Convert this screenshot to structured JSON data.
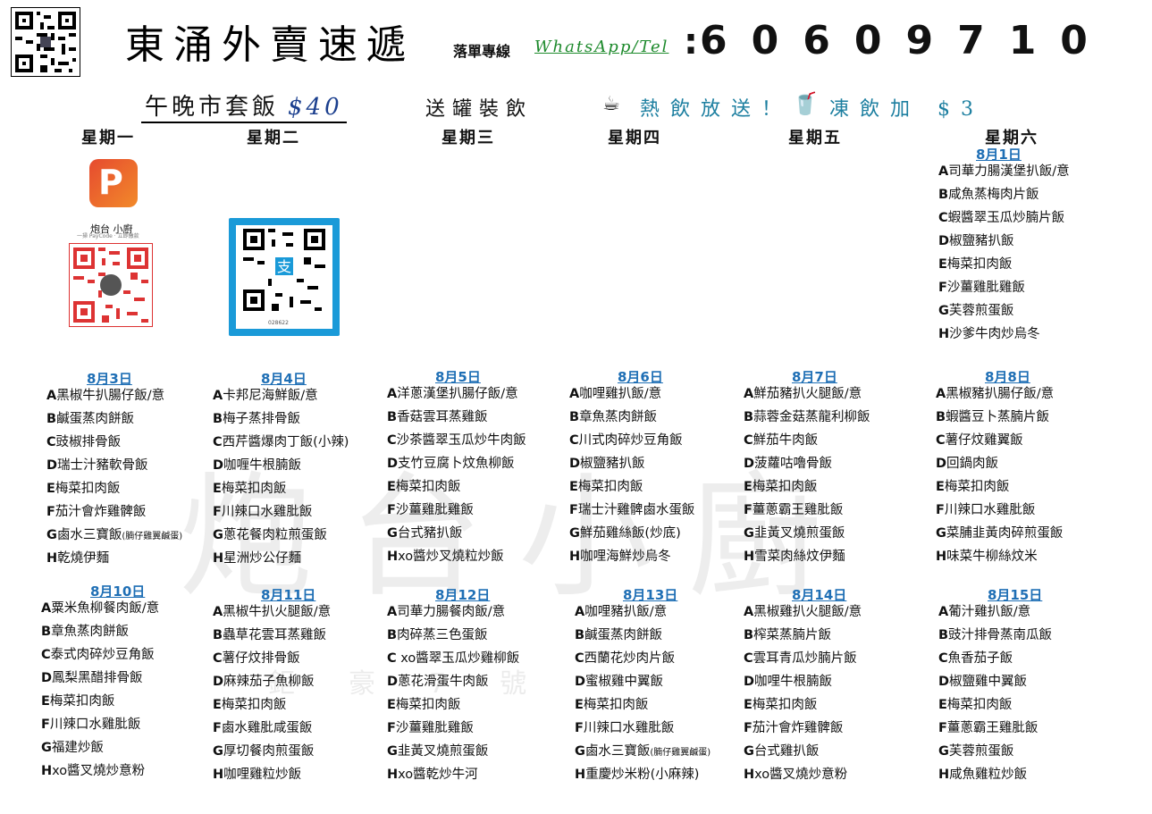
{
  "header": {
    "title": "東涌外賣速遞",
    "hotline_label": "落單專線",
    "hotline_channel": "WhatsApp/Tel",
    "hotline_colon": ":",
    "phone": "60609710"
  },
  "promo": {
    "set_meal": "午晚市套飯",
    "set_price": "$40",
    "free_can": "送罐裝飲",
    "coffee_icon": "☕",
    "hot_drink": "熱飲放送！",
    "cup_icon": "🥤",
    "cold_drink": "凍飲加 $3"
  },
  "weekdays": [
    "星期一",
    "星期二",
    "星期三",
    "星期四",
    "星期五",
    "星期六"
  ],
  "payment": {
    "kitchen_name": "炮台 小廚",
    "kitchen_sub": "一掃 PayCode · 立即繳款",
    "alipay_code": "028622"
  },
  "watermark": {
    "big": "炮台小廚",
    "small": "鉅豪7號"
  },
  "days": [
    {
      "date": "8月1日",
      "dishes": [
        {
          "l": "A",
          "t": "司華力腸漢堡扒飯/意"
        },
        {
          "l": "B",
          "t": "咸魚蒸梅肉片飯"
        },
        {
          "l": "C",
          "t": "蝦醬翠玉瓜炒腩片飯"
        },
        {
          "l": "D",
          "t": "椒鹽豬扒飯"
        },
        {
          "l": "E",
          "t": "梅菜扣肉飯"
        },
        {
          "l": "F",
          "t": "沙薑雞肶雞飯"
        },
        {
          "l": "G",
          "t": "芙蓉煎蛋飯"
        },
        {
          "l": "H",
          "t": "沙爹牛肉炒烏冬"
        }
      ]
    },
    {
      "date": "8月3日",
      "dishes": [
        {
          "l": "A",
          "t": "黑椒牛扒腸仔飯/意"
        },
        {
          "l": "B",
          "t": "鹹蛋蒸肉餅飯"
        },
        {
          "l": "C",
          "t": "豉椒排骨飯"
        },
        {
          "l": "D",
          "t": "瑞士汁豬軟骨飯"
        },
        {
          "l": "E",
          "t": "梅菜扣肉飯"
        },
        {
          "l": "F",
          "t": "茄汁會炸雞髀飯"
        },
        {
          "l": "G",
          "t": "鹵水三寶飯",
          "s": "(腩仔雞翼鹹蛋)"
        },
        {
          "l": "H",
          "t": "乾燒伊麵"
        }
      ]
    },
    {
      "date": "8月4日",
      "dishes": [
        {
          "l": "A",
          "t": "卡邦尼海鮮飯/意"
        },
        {
          "l": "B",
          "t": "梅子蒸排骨飯"
        },
        {
          "l": "C",
          "t": "西芹醬爆肉丁飯(小辣)"
        },
        {
          "l": "D",
          "t": "咖喱牛根腩飯"
        },
        {
          "l": "E",
          "t": "梅菜扣肉飯"
        },
        {
          "l": "F",
          "t": "川辣口水雞肶飯"
        },
        {
          "l": "G",
          "t": "蔥花餐肉粒煎蛋飯"
        },
        {
          "l": "H",
          "t": "星洲炒公仔麵"
        }
      ]
    },
    {
      "date": "8月5日",
      "dishes": [
        {
          "l": "A",
          "t": "洋蔥漢堡扒腸仔飯/意"
        },
        {
          "l": "B",
          "t": "香菇雲耳蒸雞飯"
        },
        {
          "l": "C",
          "t": "沙茶醬翠玉瓜炒牛肉飯"
        },
        {
          "l": "D",
          "t": "支竹豆腐卜炆魚柳飯"
        },
        {
          "l": "E",
          "t": "梅菜扣肉飯"
        },
        {
          "l": "F",
          "t": "沙薑雞肶雞飯"
        },
        {
          "l": "G",
          "t": "台式豬扒飯"
        },
        {
          "l": "H",
          "t": "xo醬炒叉燒粒炒飯"
        }
      ]
    },
    {
      "date": "8月6日",
      "dishes": [
        {
          "l": "A",
          "t": "咖哩雞扒飯/意"
        },
        {
          "l": "B",
          "t": "章魚蒸肉餅飯"
        },
        {
          "l": "C",
          "t": "川式肉碎炒豆角飯"
        },
        {
          "l": "D",
          "t": "椒鹽豬扒飯"
        },
        {
          "l": "E",
          "t": "梅菜扣肉飯"
        },
        {
          "l": "F",
          "t": "瑞士汁雞髀鹵水蛋飯"
        },
        {
          "l": "G",
          "t": "鮮茄雞絲飯(炒底)"
        },
        {
          "l": "H",
          "t": "咖哩海鮮炒烏冬"
        }
      ]
    },
    {
      "date": "8月7日",
      "dishes": [
        {
          "l": "A",
          "t": "鮮茄豬扒火腿飯/意"
        },
        {
          "l": "B",
          "t": "蒜蓉金菇蒸龍利柳飯"
        },
        {
          "l": "C",
          "t": "鮮茄牛肉飯"
        },
        {
          "l": "D",
          "t": "菠蘿咕嚕骨飯"
        },
        {
          "l": "E",
          "t": "梅菜扣肉飯"
        },
        {
          "l": "F",
          "t": "薑蔥霸王雞肶飯"
        },
        {
          "l": "G",
          "t": "韭黃叉燒煎蛋飯"
        },
        {
          "l": "H",
          "t": "雪菜肉絲炆伊麵"
        }
      ]
    },
    {
      "date": "8月8日",
      "dishes": [
        {
          "l": "A",
          "t": "黑椒豬扒腸仔飯/意"
        },
        {
          "l": "B",
          "t": "蝦醬豆卜蒸腩片飯"
        },
        {
          "l": "C",
          "t": "薯仔炆雞翼飯"
        },
        {
          "l": "D",
          "t": "回鍋肉飯"
        },
        {
          "l": "E",
          "t": "梅菜扣肉飯"
        },
        {
          "l": "F",
          "t": "川辣口水雞肶飯"
        },
        {
          "l": "G",
          "t": "菜脯韭黃肉碎煎蛋飯"
        },
        {
          "l": "H",
          "t": "味菜牛柳絲炆米"
        }
      ]
    },
    {
      "date": "8月10日",
      "dishes": [
        {
          "l": "A",
          "t": "粟米魚柳餐肉飯/意"
        },
        {
          "l": "B",
          "t": "章魚蒸肉餅飯"
        },
        {
          "l": "C",
          "t": "泰式肉碎炒豆角飯"
        },
        {
          "l": "D",
          "t": "鳳梨黑醋排骨飯"
        },
        {
          "l": "E",
          "t": "梅菜扣肉飯"
        },
        {
          "l": "F",
          "t": "川辣口水雞肶飯"
        },
        {
          "l": "G",
          "t": "福建炒飯"
        },
        {
          "l": "H",
          "t": "xo醬叉燒炒意粉"
        }
      ]
    },
    {
      "date": "8月11日",
      "dishes": [
        {
          "l": "A",
          "t": "黑椒牛扒火腿飯/意"
        },
        {
          "l": "B",
          "t": "蟲草花雲耳蒸雞飯"
        },
        {
          "l": "C",
          "t": "薯仔炆排骨飯"
        },
        {
          "l": "D",
          "t": "麻辣茄子魚柳飯"
        },
        {
          "l": "E",
          "t": "梅菜扣肉飯"
        },
        {
          "l": "F",
          "t": "鹵水雞肶咸蛋飯"
        },
        {
          "l": "G",
          "t": "厚切餐肉煎蛋飯"
        },
        {
          "l": "H",
          "t": "咖哩雞粒炒飯"
        }
      ]
    },
    {
      "date": "8月12日",
      "dishes": [
        {
          "l": "A",
          "t": "司華力腸餐肉飯/意"
        },
        {
          "l": "B",
          "t": "肉碎蒸三色蛋飯"
        },
        {
          "l": "C",
          "t": " xo醬翠玉瓜炒雞柳飯"
        },
        {
          "l": "D",
          "t": "蔥花滑蛋牛肉飯"
        },
        {
          "l": "E",
          "t": "梅菜扣肉飯"
        },
        {
          "l": "F",
          "t": "沙薑雞肶雞飯"
        },
        {
          "l": "G",
          "t": "韭黃叉燒煎蛋飯"
        },
        {
          "l": "H",
          "t": "xo醬乾炒牛河"
        }
      ]
    },
    {
      "date": "8月13日",
      "dishes": [
        {
          "l": "A",
          "t": "咖哩豬扒飯/意"
        },
        {
          "l": "B",
          "t": "鹹蛋蒸肉餅飯"
        },
        {
          "l": "C",
          "t": "西蘭花炒肉片飯"
        },
        {
          "l": "D",
          "t": "蜜椒雞中翼飯"
        },
        {
          "l": "E",
          "t": "梅菜扣肉飯"
        },
        {
          "l": "F",
          "t": "川辣口水雞肶飯"
        },
        {
          "l": "G",
          "t": "鹵水三寶飯",
          "s": "(腩仔雞翼鹹蛋)"
        },
        {
          "l": "H",
          "t": "重慶炒米粉(小麻辣)"
        }
      ]
    },
    {
      "date": "8月14日",
      "dishes": [
        {
          "l": "A",
          "t": "黑椒雞扒火腿飯/意"
        },
        {
          "l": "B",
          "t": "榨菜蒸腩片飯"
        },
        {
          "l": "C",
          "t": "雲耳青瓜炒腩片飯"
        },
        {
          "l": "D",
          "t": "咖哩牛根腩飯"
        },
        {
          "l": "E",
          "t": "梅菜扣肉飯"
        },
        {
          "l": "F",
          "t": "茄汁會炸雞髀飯"
        },
        {
          "l": "G",
          "t": "台式雞扒飯"
        },
        {
          "l": "H",
          "t": "xo醬叉燒炒意粉"
        }
      ]
    },
    {
      "date": "8月15日",
      "dishes": [
        {
          "l": "A",
          "t": "葡汁雞扒飯/意"
        },
        {
          "l": "B",
          "t": "豉汁排骨蒸南瓜飯"
        },
        {
          "l": "C",
          "t": "魚香茄子飯"
        },
        {
          "l": "D",
          "t": "椒鹽雞中翼飯"
        },
        {
          "l": "E",
          "t": "梅菜扣肉飯"
        },
        {
          "l": "F",
          "t": "薑蔥霸王雞肶飯"
        },
        {
          "l": "G",
          "t": "芙蓉煎蛋飯"
        },
        {
          "l": "H",
          "t": "咸魚雞粒炒飯"
        }
      ]
    }
  ]
}
